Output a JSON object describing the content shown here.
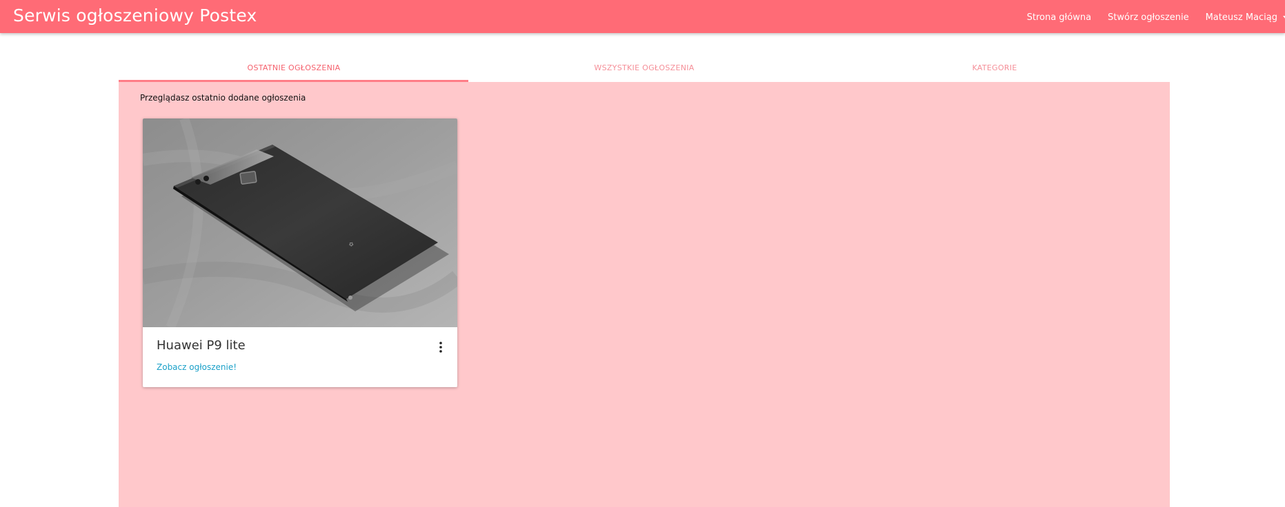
{
  "header": {
    "brand": "Serwis ogłoszeniowy Postex",
    "nav": {
      "home": "Strona główna",
      "create": "Stwórz ogłoszenie",
      "user": "Mateusz Maciąg"
    }
  },
  "tabs": [
    {
      "label": "OSTATNIE OGŁOSZENIA",
      "active": true
    },
    {
      "label": "WSZYSTKIE OGŁOSZENIA",
      "active": false
    },
    {
      "label": "KATEGORIE",
      "active": false
    }
  ],
  "panel": {
    "caption": "Przeglądasz ostatnio dodane ogłoszenia"
  },
  "cards": [
    {
      "title": "Huawei P9 lite",
      "link": "Zobacz ogłoszenie!",
      "image": "phone-photo",
      "more_icon": "more-vertical-icon"
    }
  ],
  "colors": {
    "navbar": "#ff6b76",
    "panel": "#ffc8cb",
    "tab_active": "#f5606c",
    "tab_inactive": "#f58f98",
    "link": "#1aa0c8"
  }
}
